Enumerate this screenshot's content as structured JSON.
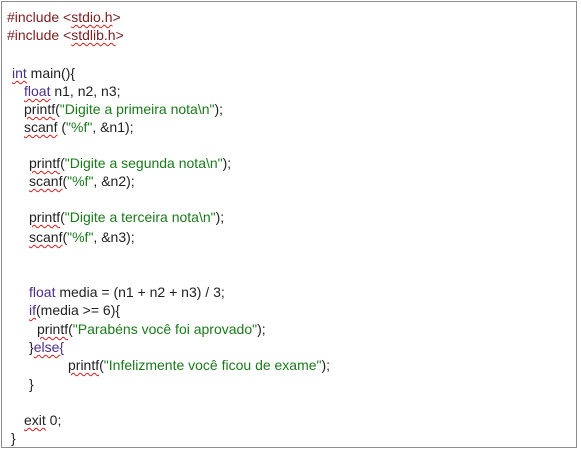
{
  "lines": [
    {
      "tokens": [
        {
          "t": "#include ",
          "c": "dir"
        },
        {
          "t": "<",
          "c": "dir"
        },
        {
          "t": "stdio.h",
          "c": "dir",
          "sp": true
        },
        {
          "t": ">",
          "c": "dir"
        }
      ]
    },
    {
      "tokens": [
        {
          "t": "#include ",
          "c": "dir"
        },
        {
          "t": "<",
          "c": "dir"
        },
        {
          "t": "stdlib.h",
          "c": "dir",
          "sp": true
        },
        {
          "t": ">",
          "c": "dir"
        }
      ]
    },
    {
      "tokens": [
        {
          "t": "int",
          "c": "kw",
          "sp": true
        },
        {
          "t": " main(){",
          "c": "ident"
        }
      ]
    },
    {
      "tokens": [
        {
          "t": "float",
          "c": "kw",
          "sp": true
        },
        {
          "t": " n1, n2, n3;",
          "c": "ident"
        }
      ]
    },
    {
      "tokens": [
        {
          "t": "printf",
          "c": "ident",
          "sp": true
        },
        {
          "t": "(",
          "c": "ident"
        },
        {
          "t": "\"Digite a primeira nota\\n\"",
          "c": "str"
        },
        {
          "t": ");",
          "c": "ident"
        }
      ]
    },
    {
      "tokens": [
        {
          "t": "scanf",
          "c": "ident",
          "sp": true
        },
        {
          "t": " (",
          "c": "ident"
        },
        {
          "t": "\"%f\"",
          "c": "str"
        },
        {
          "t": ", &n1);",
          "c": "ident"
        }
      ]
    },
    {
      "tokens": [
        {
          "t": "printf",
          "c": "ident",
          "sp": true
        },
        {
          "t": "(",
          "c": "ident"
        },
        {
          "t": "\"Digite a segunda nota\\n\"",
          "c": "str"
        },
        {
          "t": ");",
          "c": "ident"
        }
      ]
    },
    {
      "tokens": [
        {
          "t": "scanf",
          "c": "ident",
          "sp": true
        },
        {
          "t": "(",
          "c": "ident"
        },
        {
          "t": "\"%f\"",
          "c": "str"
        },
        {
          "t": ", &n2);",
          "c": "ident"
        }
      ]
    },
    {
      "tokens": [
        {
          "t": "printf",
          "c": "ident",
          "sp": true
        },
        {
          "t": "(",
          "c": "ident"
        },
        {
          "t": "\"Digite a terceira nota\\n\"",
          "c": "str"
        },
        {
          "t": ");",
          "c": "ident"
        }
      ]
    },
    {
      "tokens": [
        {
          "t": "scanf",
          "c": "ident",
          "sp": true
        },
        {
          "t": "(",
          "c": "ident"
        },
        {
          "t": "\"%f\"",
          "c": "str"
        },
        {
          "t": ", &n3);",
          "c": "ident"
        }
      ]
    },
    {
      "tokens": [
        {
          "t": "float",
          "c": "kw"
        },
        {
          "t": " media = (n1 + n2 + n3) / 3;",
          "c": "ident"
        }
      ]
    },
    {
      "tokens": [
        {
          "t": "if",
          "c": "kw",
          "sp": true
        },
        {
          "t": "(media >= 6){",
          "c": "ident"
        }
      ]
    },
    {
      "tokens": [
        {
          "t": "printf",
          "c": "ident",
          "sp": true
        },
        {
          "t": "(",
          "c": "ident"
        },
        {
          "t": "\"Parabéns você foi aprovado\"",
          "c": "str"
        },
        {
          "t": ");",
          "c": "ident"
        }
      ]
    },
    {
      "tokens": [
        {
          "t": "}",
          "c": "ident"
        },
        {
          "t": "else{",
          "c": "kw",
          "sp": true
        }
      ]
    },
    {
      "tokens": [
        {
          "t": "printf",
          "c": "ident",
          "sp": true
        },
        {
          "t": "(",
          "c": "ident"
        },
        {
          "t": "\"Infelizmente você ficou de exame\"",
          "c": "str"
        },
        {
          "t": ");",
          "c": "ident"
        }
      ]
    },
    {
      "tokens": [
        {
          "t": "}",
          "c": "ident"
        }
      ]
    },
    {
      "tokens": [
        {
          "t": "exit",
          "c": "ident",
          "sp": true
        },
        {
          "t": " 0;",
          "c": "ident"
        }
      ]
    },
    {
      "tokens": [
        {
          "t": "}",
          "c": "ident"
        }
      ]
    }
  ]
}
